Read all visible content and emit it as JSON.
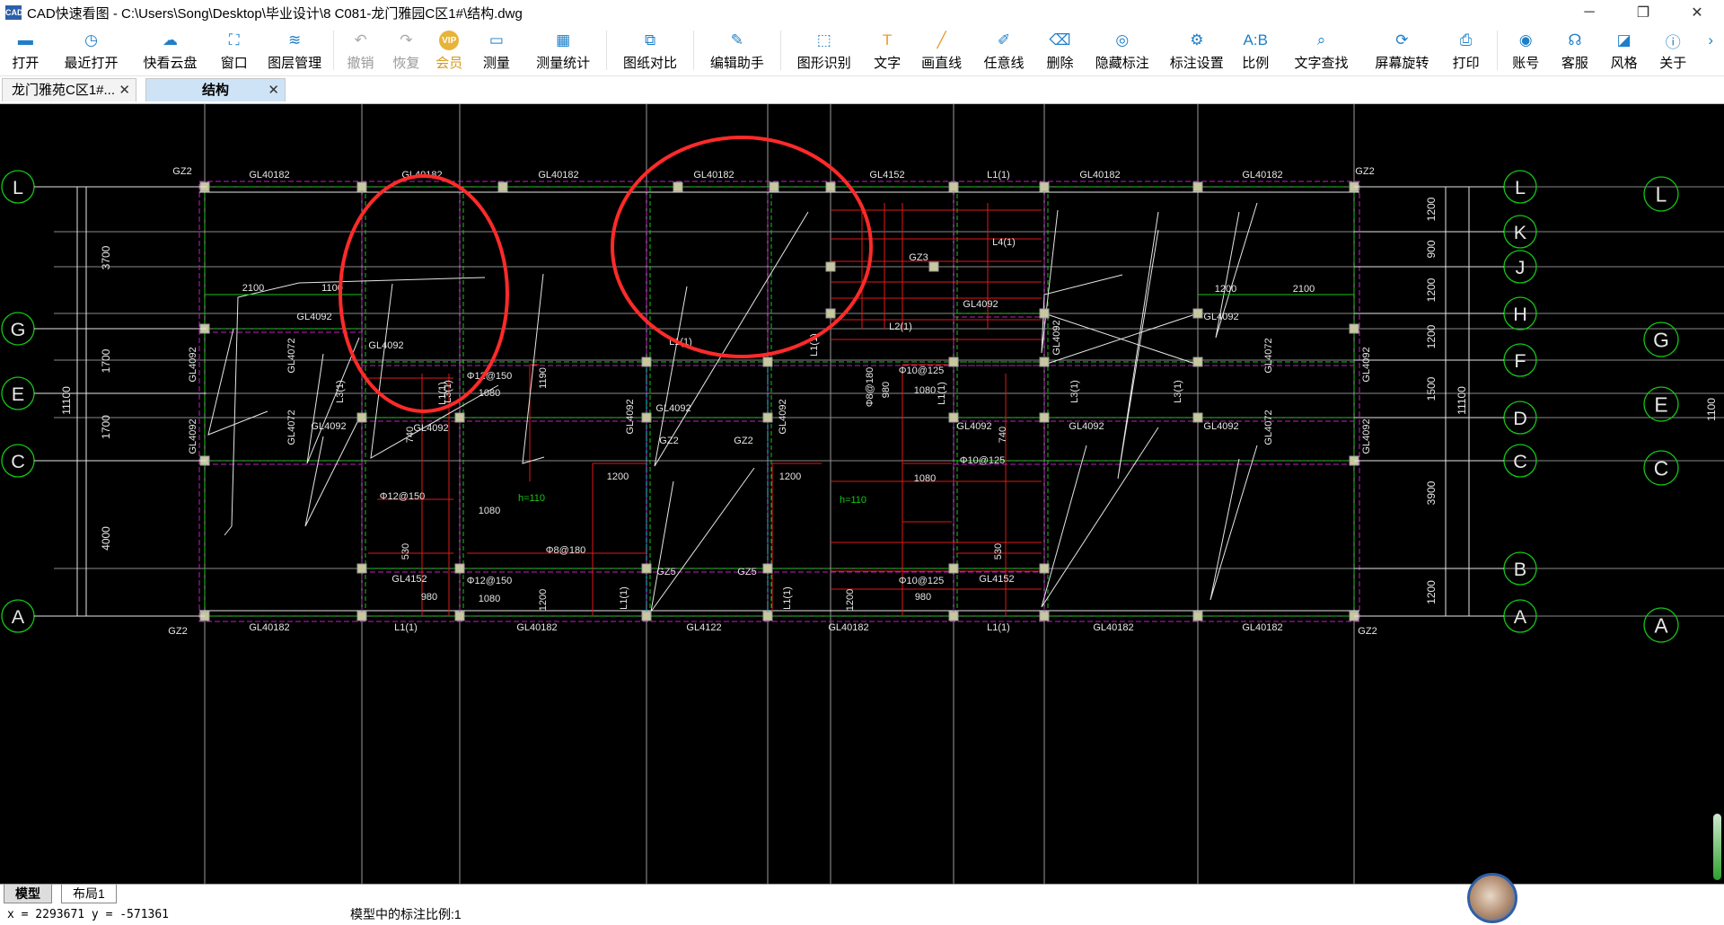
{
  "window": {
    "app_icon_text": "CAD",
    "title": "CAD快速看图 - C:\\Users\\Song\\Desktop\\毕业设计\\8 C081-龙门雅园C区1#\\结构.dwg",
    "minimize": "─",
    "maximize": "❐",
    "close": "✕"
  },
  "toolbar": [
    {
      "label": "打开",
      "icon": "folder-icon",
      "glyph": "▬"
    },
    {
      "label": "最近打开",
      "icon": "clock-icon",
      "glyph": "◷"
    },
    {
      "label": "快看云盘",
      "icon": "cloud-icon",
      "glyph": "☁"
    },
    {
      "label": "窗口",
      "icon": "window-icon",
      "glyph": "⛶"
    },
    {
      "label": "图层管理",
      "icon": "layers-icon",
      "glyph": "≋"
    },
    {
      "label": "撤销",
      "icon": "undo-icon",
      "glyph": "↶",
      "disabled": true
    },
    {
      "label": "恢复",
      "icon": "redo-icon",
      "glyph": "↷",
      "disabled": true
    },
    {
      "label": "会员",
      "icon": "vip-icon",
      "glyph": "VIP",
      "vip": true
    },
    {
      "label": "测量",
      "icon": "ruler-icon",
      "glyph": "▭"
    },
    {
      "label": "测量统计",
      "icon": "measure-stats-icon",
      "glyph": "▦"
    },
    {
      "label": "图纸对比",
      "icon": "compare-icon",
      "glyph": "⧉"
    },
    {
      "label": "编辑助手",
      "icon": "edit-assistant-icon",
      "glyph": "✎"
    },
    {
      "label": "图形识别",
      "icon": "shape-recognition-icon",
      "glyph": "⬚"
    },
    {
      "label": "文字",
      "icon": "text-icon",
      "glyph": "T"
    },
    {
      "label": "画直线",
      "icon": "line-icon",
      "glyph": "╱"
    },
    {
      "label": "任意线",
      "icon": "pen-icon",
      "glyph": "✐"
    },
    {
      "label": "删除",
      "icon": "eraser-icon",
      "glyph": "⌫"
    },
    {
      "label": "隐藏标注",
      "icon": "hide-annotation-icon",
      "glyph": "◎"
    },
    {
      "label": "标注设置",
      "icon": "annotation-settings-icon",
      "glyph": "⚙"
    },
    {
      "label": "比例",
      "icon": "scale-icon",
      "glyph": "A:B"
    },
    {
      "label": "文字查找",
      "icon": "text-search-icon",
      "glyph": "⌕"
    },
    {
      "label": "屏幕旋转",
      "icon": "rotate-screen-icon",
      "glyph": "⟳"
    },
    {
      "label": "打印",
      "icon": "printer-icon",
      "glyph": "⎙"
    },
    {
      "label": "账号",
      "icon": "account-icon",
      "glyph": "◉"
    },
    {
      "label": "客服",
      "icon": "headset-icon",
      "glyph": "☊"
    },
    {
      "label": "风格",
      "icon": "style-icon",
      "glyph": "◪"
    },
    {
      "label": "关于",
      "icon": "info-icon",
      "glyph": "ⓘ"
    }
  ],
  "overflow_glyph": "›",
  "tabs": [
    {
      "label": "龙门雅苑C区1#...",
      "close": "✕",
      "active": false
    },
    {
      "label": "结构",
      "close": "✕",
      "active": true
    }
  ],
  "layout_tabs": [
    {
      "label": "模型",
      "active": true
    },
    {
      "label": "布局1",
      "active": false
    }
  ],
  "status": {
    "coords": "x = 2293671  y = -571361",
    "scale": "模型中的标注比例:1"
  },
  "drawing": {
    "top_beams": [
      "GL40182",
      "GL40182",
      "GL40182",
      "GL40182",
      "GL4152",
      "L1(1)",
      "GL40182",
      "GL40182"
    ],
    "bottom_beams": [
      "GL40182",
      "L1(1)",
      "GL40182",
      "GL4122",
      "GL40182",
      "L1(1)",
      "GL40182",
      "GL40182"
    ],
    "corner_columns": [
      "GZ2",
      "GZ2",
      "GZ2",
      "GZ2"
    ],
    "left_axes": [
      "L",
      "G",
      "E",
      "C",
      "A"
    ],
    "mid_axes": [
      "L",
      "K",
      "J",
      "H",
      "F",
      "D",
      "C",
      "B",
      "A"
    ],
    "right_axes": [
      "L",
      "G",
      "E",
      "C",
      "A"
    ],
    "left_dims": [
      "3700",
      "1700",
      "1700",
      "4000"
    ],
    "left_total": "11100",
    "right_dims": [
      "1200",
      "900",
      "1200",
      "1200",
      "1500",
      "3900",
      "1200"
    ],
    "right_total": "11100",
    "far_right_total": "1100",
    "span_dims": [
      "2100",
      "1100",
      "1200",
      "2100"
    ],
    "labels": {
      "gl4092": "GL4092",
      "gl4072": "GL4072",
      "gl4152": "GL4152",
      "gz2": "GZ2",
      "gz3": "GZ3",
      "gz5": "GZ5",
      "l2": "L2(1)",
      "l3": "L3(1)",
      "l4": "L4(1)",
      "l1": "L1(1)",
      "bar12": "Φ12@150",
      "bar10": "Φ10@125",
      "bar8": "Φ8@180",
      "bar8b": "Φ8@180",
      "h1": "h=110",
      "h2": "h=110",
      "d1080": "1080",
      "d1190": "1190",
      "d1200": "1200",
      "d980": "980",
      "d740": "740",
      "d530": "530"
    }
  }
}
